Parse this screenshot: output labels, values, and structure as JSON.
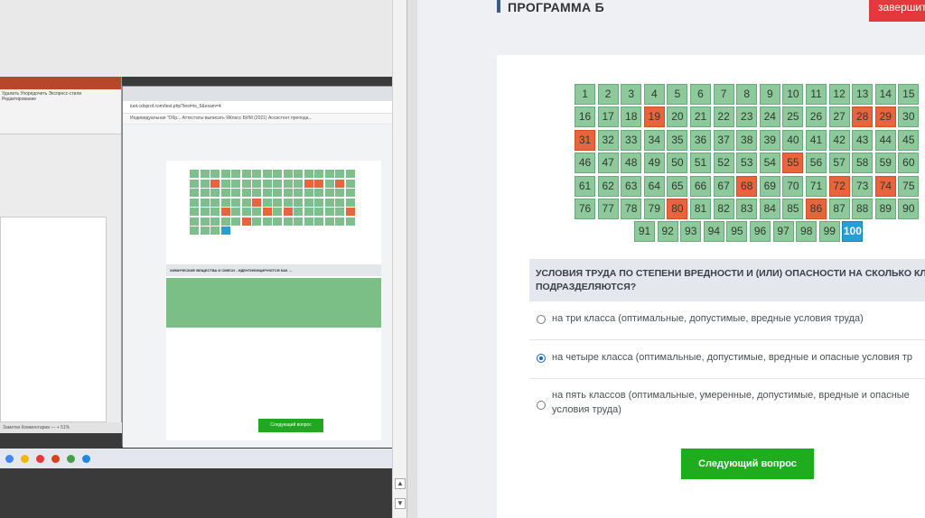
{
  "page": {
    "title": "ПРОГРАММА Б",
    "finish_label": "завершит"
  },
  "question": {
    "text": "УСЛОВИЯ ТРУДА ПО СТЕПЕНИ ВРЕДНОСТИ И (ИЛИ) ОПАСНОСТИ НА СКОЛЬКО КЛАССО",
    "text2": "ПОДРАЗДЕЛЯЮТСЯ?",
    "options": [
      {
        "label": "на три класса (оптимальные, допустимые, вредные условия труда)",
        "selected": false
      },
      {
        "label": "на четыре класса (оптимальные, допустимые, вредные и опасные условия тр",
        "selected": true
      },
      {
        "label": "на пять классов (оптимальные, умеренные, допустимые, вредные и опасные",
        "label2": "условия труда)",
        "selected": false
      }
    ],
    "next_label": "Следующий вопрос"
  },
  "grid": {
    "total": 100,
    "wrong": [
      19,
      28,
      29,
      31,
      55,
      68,
      72,
      74,
      80,
      86
    ],
    "current": 100,
    "colors": {
      "done": "#8dc99a",
      "wrong": "#e8643c",
      "current": "#24a0d6"
    }
  },
  "mini_browser": {
    "address": "iuot.cdoprof.com/test.php?test=ts_6&exam=4",
    "bookmarks": "Индивидуальная \"Обр...   Аттестаты выписать   ЯКласс   БИМ (2021)   Ассистент препода...",
    "question": "ХИМИЧЕСКИЕ ВЕЩЕСТВА И СМЕСИ - ИДЕНТИФИЦИРУЮТСЯ КАК ...",
    "next_label": "Следующий вопрос"
  },
  "ppt": {
    "ribbon": "Удалить   Упорядочить   Экспресс-стили   Редактирование",
    "status": "Заметки   Комментарии   — + 51%"
  }
}
